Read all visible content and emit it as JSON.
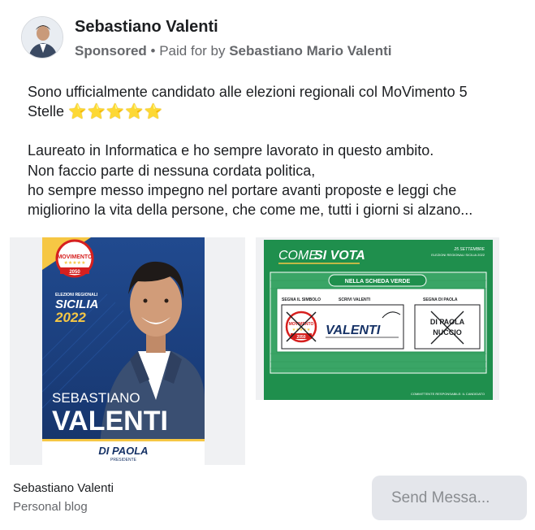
{
  "post": {
    "author": "Sebastiano Valenti",
    "sponsored_label": "Sponsored",
    "separator": "•",
    "paid_for_prefix": "Paid for by",
    "paid_for_name": "Sebastiano Mario Valenti",
    "lines": [
      "Sono ufficialmente candidato alle elezioni regionali col MoVimento 5",
      "Stelle",
      "Laureato in Informatica e ho sempre lavorato in questo ambito.",
      "Non faccio parte di nessuna cordata politica,",
      "ho sempre messo impegno nel portare avanti proposte e leggi che",
      "migliorino la vita della persone, che come me, tutti i giorni si alzano..."
    ],
    "stars_emoji": "⭐⭐⭐⭐⭐"
  },
  "poster": {
    "logo_text": "MOVIMENTO",
    "logo_year": "2050",
    "elections_label": "ELEZIONI REGIONALI",
    "region": "SICILIA",
    "year": "2022",
    "first_name": "SEBASTIANO",
    "last_name": "VALENTI",
    "coalition": "DI PAOLA",
    "coalition_sub": "PRESIDENTE"
  },
  "vote_card": {
    "title_part1": "COME ",
    "title_part2": "SI VOTA",
    "date": "25 SETTEMBRE",
    "date_sub": "ELEZIONI REGIONALI SICILIA 2022",
    "banner": "NELLA SCHEDA VERDE",
    "col1_label": "SEGNA IL SIMBOLO",
    "col2_label": "SCRIVI VALENTI",
    "col3_label": "SEGNA DI PAOLA",
    "written_name": "VALENTI",
    "president_line1": "DI PAOLA",
    "president_line2": "NUCCIO",
    "logo_text": "MOVIMENTO",
    "logo_year": "2050",
    "footer": "COMMITTENTE RESPONSABILE: IL CANDIDATO"
  },
  "footer": {
    "page_name": "Sebastiano Valenti",
    "page_category": "Personal blog",
    "button_label": "Send Messa..."
  },
  "colors": {
    "accent_yellow": "#f6c744",
    "poster_blue": "#1a3d7a",
    "card_green": "#1f8f4d",
    "ms_red": "#d6201f"
  }
}
